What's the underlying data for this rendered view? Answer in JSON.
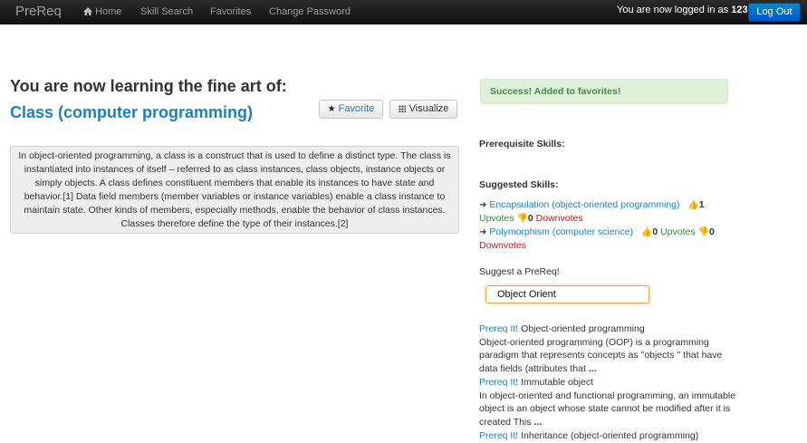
{
  "navbar": {
    "brand": "PreReq",
    "items": [
      "Home",
      "Skill Search",
      "Favorites",
      "Change Password"
    ],
    "login_prefix": "You are now logged in as ",
    "username": "123",
    "login_suffix": ".",
    "logout_label": "Log Out"
  },
  "main": {
    "heading": "You are now learning the fine art of:",
    "skill_title": "Class (computer programming)",
    "favorite_label": "Favorite",
    "visualize_label": "Visualize",
    "description": "In object-oriented programming, a class is a construct that is used to define a distinct type. The class is instantiated into instances of itself – referred to as class instances, class objects, instance objects or simply objects. A class defines constituent members that enable its instances to have state and behavior.[1] Data field members (member variables or instance variables) enable a class instance to maintain state. Other kinds of members, especially methods, enable the behavior of class instances. Classes therefore define the type of their instances.[2]"
  },
  "sidebar": {
    "alert": "Success! Added to favorites!",
    "prereq_heading": "Prerequisite Skills:",
    "suggested_heading": "Suggested Skills:",
    "suggested": [
      {
        "name": "Encapsulation (object-oriented programming)",
        "upvotes": "1",
        "upvotes_label": "Upvotes",
        "downvotes": "0",
        "downvotes_label": "Downvotes"
      },
      {
        "name": "Polymorphism (computer science)",
        "upvotes": "0",
        "upvotes_label": "Upvotes",
        "downvotes": "0",
        "downvotes_label": "Downvotes"
      }
    ],
    "suggest_label": "Suggest a PreReq!",
    "search_value": "Object Orient",
    "results": [
      {
        "link": "Prereq It!",
        "title": "Object-oriented programming",
        "snippet": "Object-oriented programming (OOP) is a programming paradigm that represents concepts as \"objects \" that have data fields (attributes that",
        "more": "..."
      },
      {
        "link": "Prereq It!",
        "title": "Immutable object",
        "snippet": "In object-oriented and functional programming, an immutable object is an object whose state cannot be modified after it is created This",
        "more": "..."
      },
      {
        "link": "Prereq It!",
        "title": "Inheritance (object-oriented programming)",
        "snippet": "",
        "more": ""
      }
    ]
  }
}
